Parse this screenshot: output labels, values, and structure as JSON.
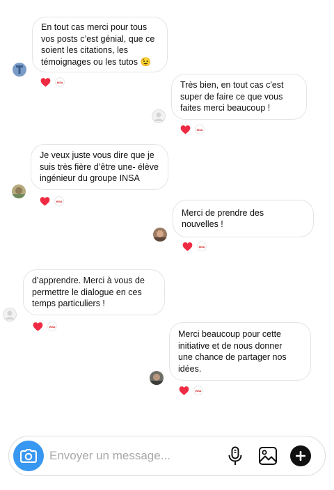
{
  "messages": [
    {
      "side": "received",
      "text": "En tout cas merci pour tous\nvos posts c’est génial, que ce\nsoient les citations, les\ntémoignages ou les tutos 😉",
      "reactor": "INSA"
    },
    {
      "side": "sent",
      "text": "Très bien, en tout cas c'est\nsuper de faire ce que vous\nfaites merci beaucoup !",
      "reactor": "INSA"
    },
    {
      "side": "received",
      "text": "Je veux juste vous dire que je\nsuis très fière d’être une- élève\ningénieur du groupe INSA",
      "reactor": "INSA"
    },
    {
      "side": "sent",
      "text": "Merci de prendre des\nnouvelles !",
      "reactor": "INSA"
    },
    {
      "side": "received",
      "text": "d’apprendre. Merci à vous de\npermettre le dialogue en ces\ntemps particuliers !",
      "reactor": "INSA"
    },
    {
      "side": "sent",
      "text": "Merci beaucoup pour cette\ninitiative et de nous donner\nune chance de partager nos\nidées.",
      "reactor": "INSA"
    }
  ],
  "composer": {
    "placeholder": "Envoyer un message...",
    "camera_icon": "camera-icon",
    "mic_icon": "microphone-icon",
    "gallery_icon": "image-gallery-icon",
    "plus_icon": "plus-icon"
  },
  "colors": {
    "heart": "#ef2b43",
    "camera_bg": "#3897f0",
    "bubble_border": "#e4e4e4",
    "placeholder": "#a8a8a8"
  }
}
